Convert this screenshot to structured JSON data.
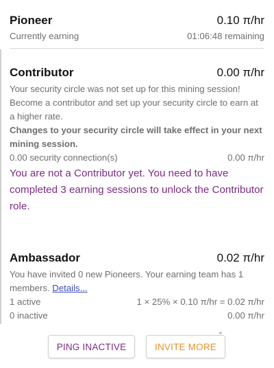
{
  "pioneer": {
    "title": "Pioneer",
    "rate": "0.10 π/hr",
    "status": "Currently earning",
    "remaining": "01:06:48 remaining"
  },
  "contributor": {
    "title": "Contributor",
    "rate": "0.00 π/hr",
    "description": "Your security circle was not set up for this mining session! Become a contributor and set up your security circle to earn at a higher rate.",
    "note": "Changes to your security circle will take effect in your next mining session.",
    "connections_label": "0.00 security connection(s)",
    "connections_rate": "0.00 π/hr",
    "locked_message": "You are not a Contributor yet. You need to have completed 3 earning sessions to unlock the Contributor role."
  },
  "ambassador": {
    "title": "Ambassador",
    "rate": "0.02 π/hr",
    "description": "You have invited 0 new Pioneers. Your earning team has 1 members.",
    "details_link": "Details...",
    "active_label": "1 active",
    "active_formula": "1 × 25% × 0.10 π/hr = 0.02 π/hr",
    "inactive_label": "0 inactive",
    "inactive_rate": "0.00 π/hr"
  },
  "actions": {
    "ping_label": "PING INACTIVE",
    "invite_label": "INVITE MORE"
  },
  "colors": {
    "accent_purple": "#7b2a84",
    "accent_orange": "#e8902a",
    "link_blue": "#3a4cc0",
    "muted_text": "#6e6e6e"
  }
}
